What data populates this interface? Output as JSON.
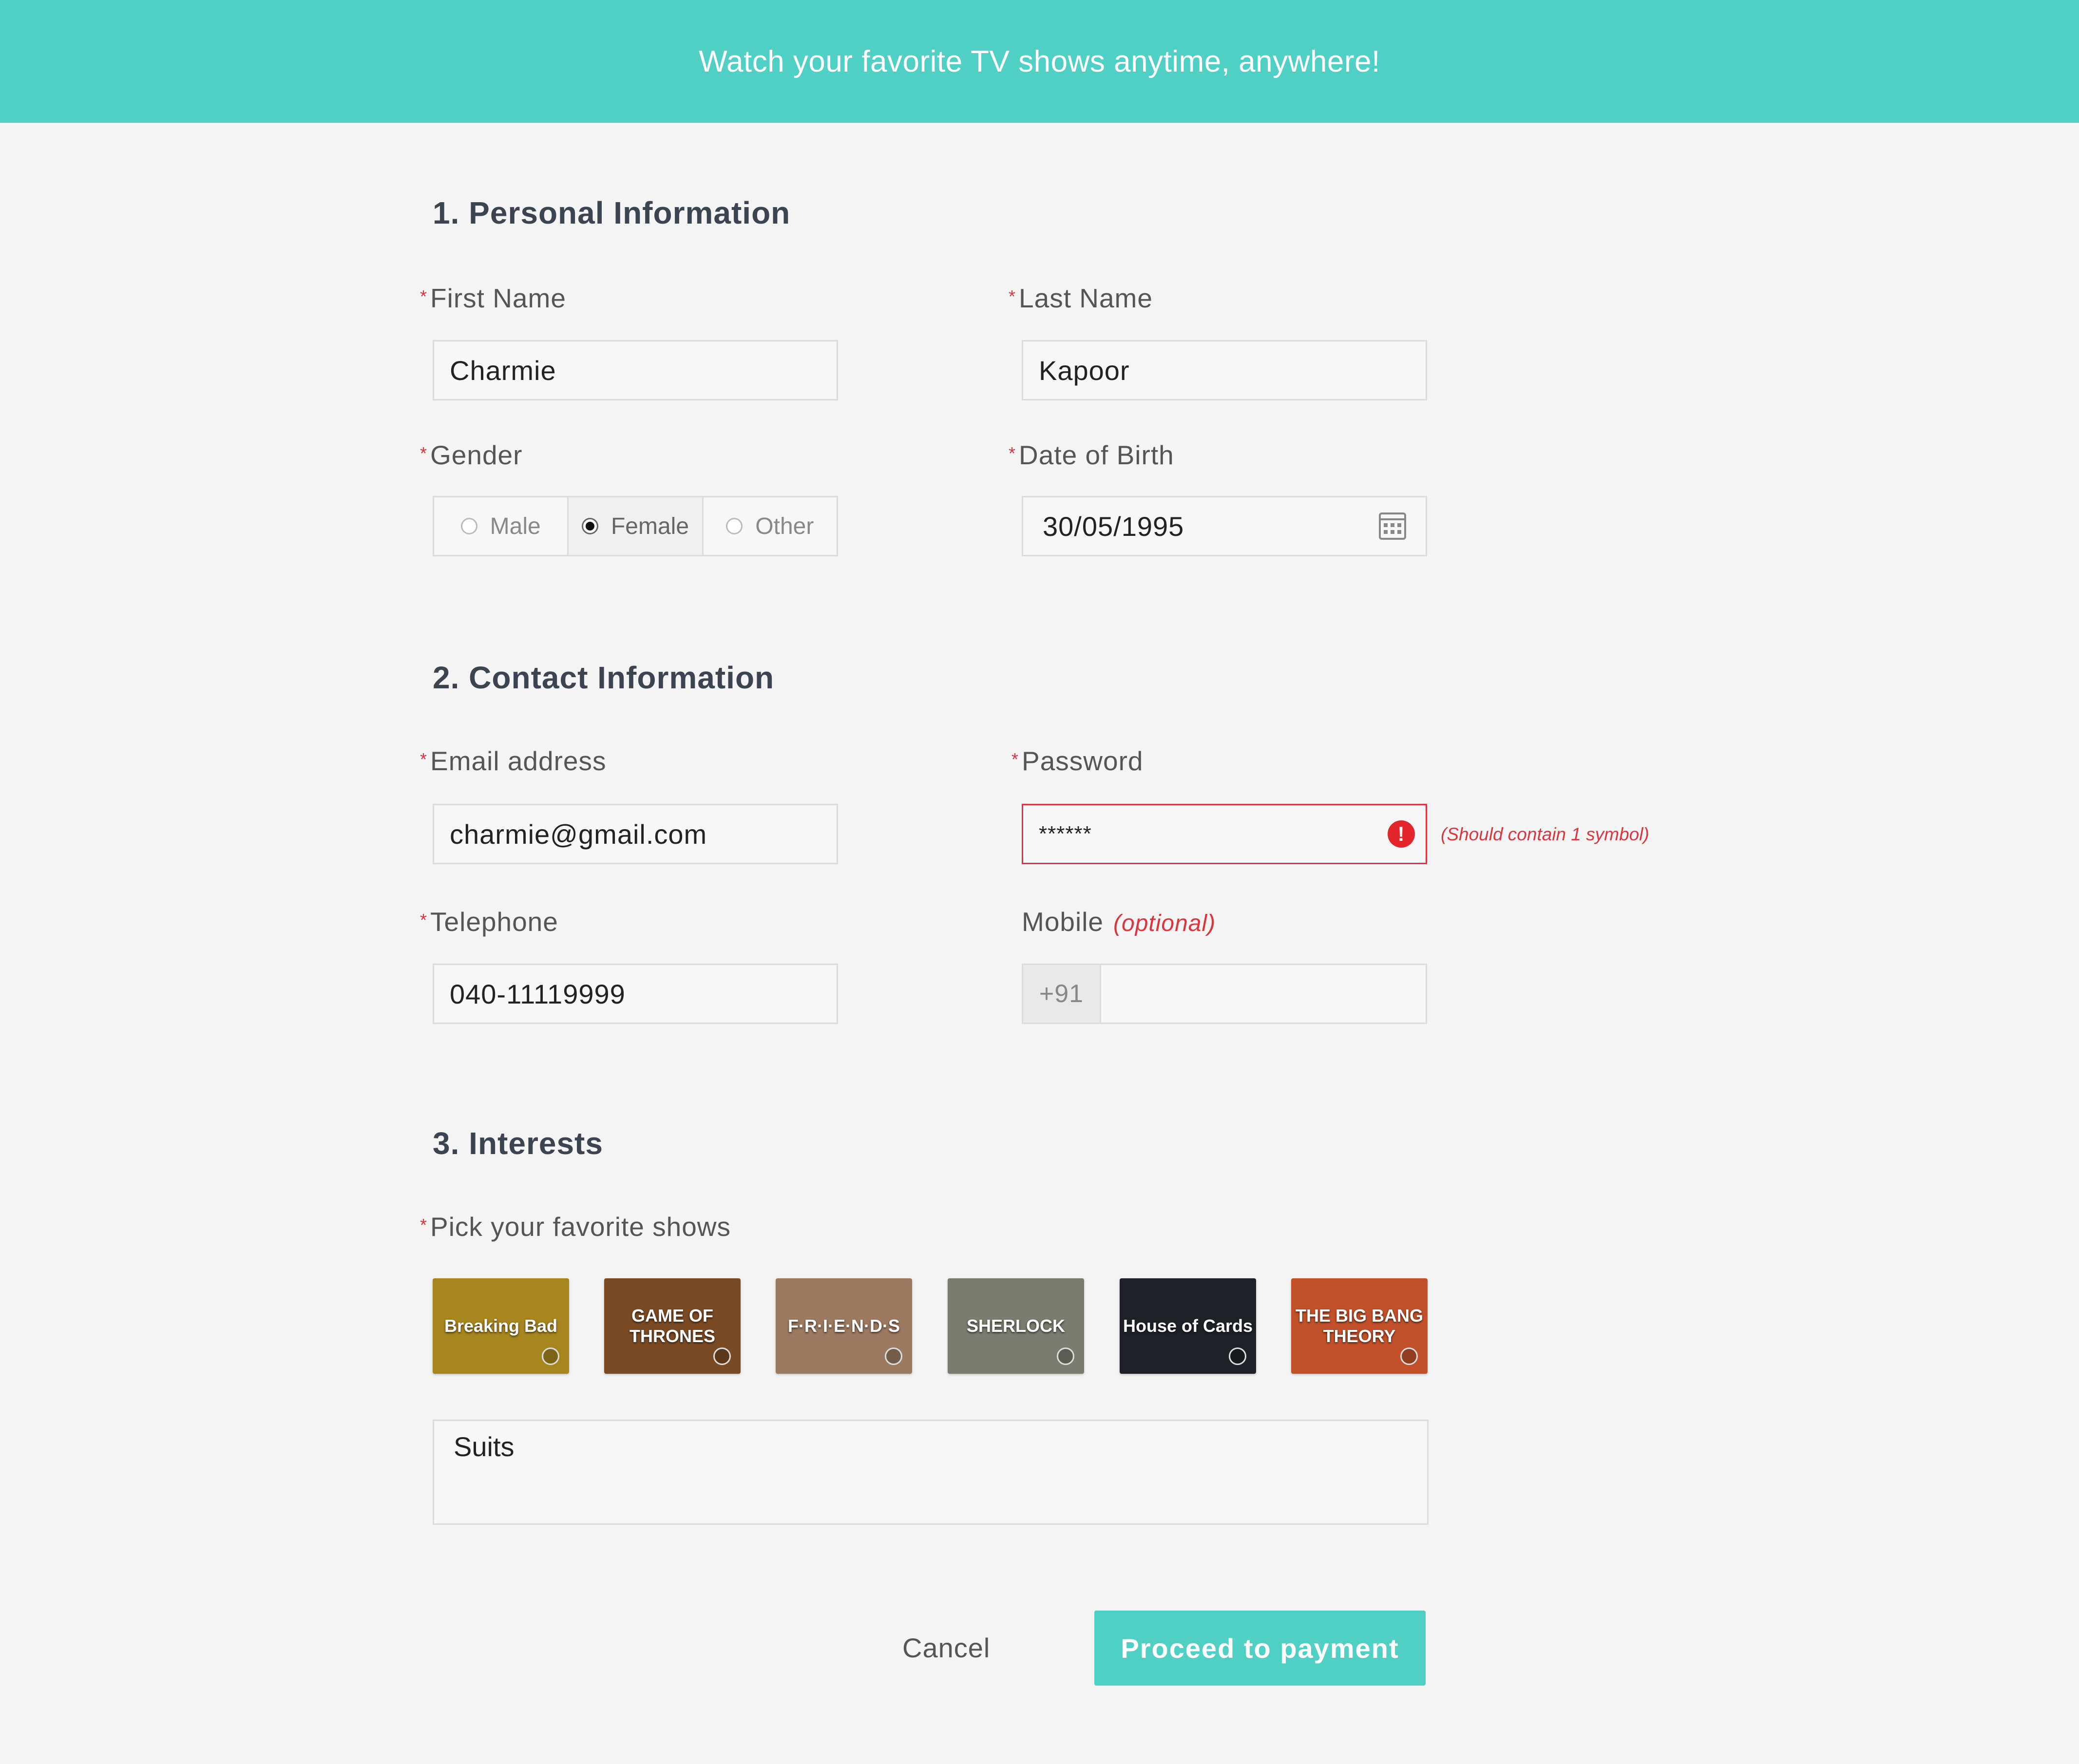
{
  "banner": {
    "text": "Watch your favorite TV shows anytime, anywhere!"
  },
  "sections": {
    "personal": {
      "title": "1. Personal Information",
      "first_name": {
        "label": "First Name",
        "value": "Charmie"
      },
      "last_name": {
        "label": "Last Name",
        "value": "Kapoor"
      },
      "gender": {
        "label": "Gender",
        "options": [
          "Male",
          "Female",
          "Other"
        ],
        "selected": "Female"
      },
      "dob": {
        "label": "Date of Birth",
        "value": "30/05/1995",
        "icon": "calendar-icon"
      }
    },
    "contact": {
      "title": "2. Contact Information",
      "email": {
        "label": "Email address",
        "value": "charmie@gmail.com"
      },
      "password": {
        "label": "Password",
        "value": "******",
        "error": "(Should contain 1 symbol)",
        "error_icon": "!"
      },
      "telephone": {
        "label": "Telephone",
        "value": "040-11119999"
      },
      "mobile": {
        "label": "Mobile",
        "optional": "(optional)",
        "prefix": "+91",
        "value": ""
      }
    },
    "interests": {
      "title": "3. Interests",
      "label": "Pick your favorite shows",
      "shows": [
        {
          "name": "Breaking Bad",
          "color": "#a7861f"
        },
        {
          "name": "GAME OF THRONES",
          "color": "#7a4a25"
        },
        {
          "name": "F·R·I·E·N·D·S",
          "color": "#9c7a62"
        },
        {
          "name": "SHERLOCK",
          "color": "#7b7b70"
        },
        {
          "name": "House of Cards",
          "color": "#1e2228"
        },
        {
          "name": "THE BIG BANG THEORY",
          "color": "#c2512b"
        }
      ],
      "other_value": "Suits"
    }
  },
  "actions": {
    "cancel": "Cancel",
    "proceed": "Proceed to payment"
  },
  "colors": {
    "accent": "#50cfc4",
    "error": "#d9363e"
  }
}
